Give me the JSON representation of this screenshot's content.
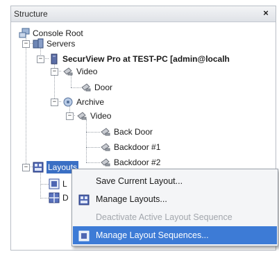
{
  "panel": {
    "title": "Structure",
    "close_glyph": "×"
  },
  "tree": {
    "console_root": "Console Root",
    "servers": "Servers",
    "server": "SecurView Pro at TEST-PC [admin@localh",
    "video": "Video",
    "door": "Door",
    "archive": "Archive",
    "archive_video": "Video",
    "back_door": "Back Door",
    "backdoor1": "Backdoor #1",
    "backdoor2": "Backdoor #2",
    "layouts": "Layouts",
    "layout_child1": "L",
    "layout_child2": "D"
  },
  "expanders": {
    "collapse": "−"
  },
  "context_menu": {
    "items": [
      {
        "label": "Save Current Layout...",
        "icon": "none",
        "enabled": true
      },
      {
        "label": "Manage Layouts...",
        "icon": "manage-layouts-icon",
        "enabled": true
      },
      {
        "label": "Deactivate Active Layout Sequence",
        "icon": "none",
        "enabled": false
      },
      {
        "label": "Manage Layout Sequences...",
        "icon": "layout-sequence-icon",
        "enabled": true,
        "highlighted": true
      }
    ]
  },
  "colors": {
    "selection": "#3a6fc4",
    "menu_highlight": "#3d7bd6",
    "disabled_text": "#a2a6ac"
  }
}
